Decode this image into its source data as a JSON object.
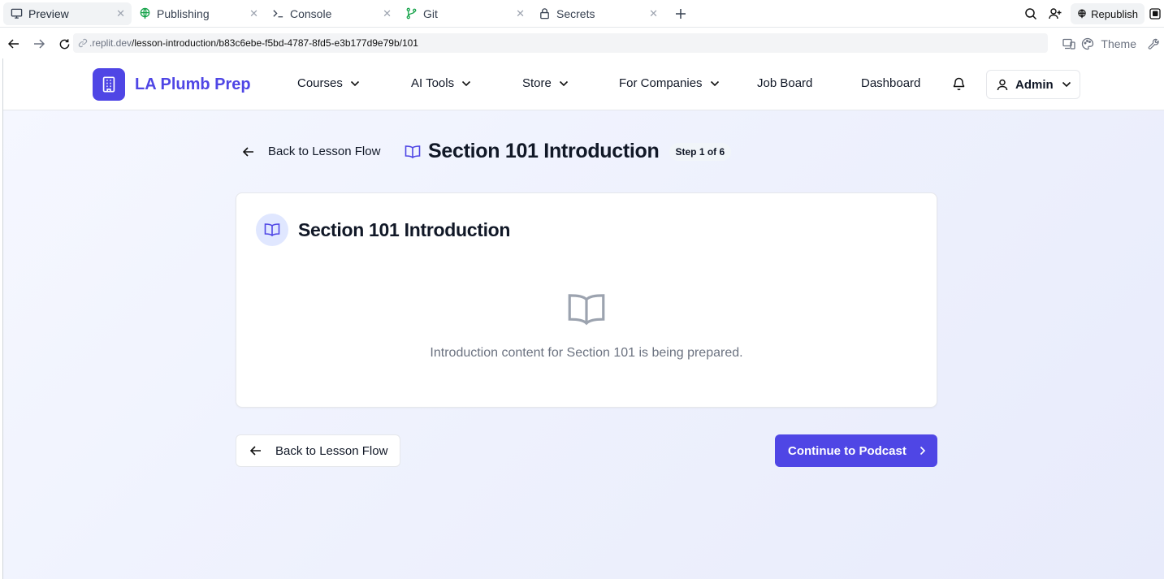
{
  "ide": {
    "tabs": [
      {
        "label": "Preview",
        "icon": "monitor-icon",
        "active": true
      },
      {
        "label": "Publishing",
        "icon": "globe-icon"
      },
      {
        "label": "Console",
        "icon": "terminal-icon"
      },
      {
        "label": "Git",
        "icon": "git-branch-icon"
      },
      {
        "label": "Secrets",
        "icon": "lock-icon"
      }
    ],
    "republish_label": "Republish"
  },
  "urlbar": {
    "host": ".replit.dev",
    "path": "/lesson-introduction/b83c6ebe-f5bd-4787-8fd5-e3b177d9e79b/101",
    "theme_label": "Theme"
  },
  "header": {
    "brand": "LA Plumb Prep",
    "nav": {
      "courses": "Courses",
      "ai_tools": "AI Tools",
      "store": "Store",
      "for_companies": "For Companies",
      "job_board": "Job Board",
      "dashboard": "Dashboard"
    },
    "user_label": "Admin"
  },
  "page": {
    "back_label": "Back to Lesson Flow",
    "title": "Section 101 Introduction",
    "step_badge": "Step 1 of 6"
  },
  "card": {
    "title": "Section 101 Introduction",
    "empty_message": "Introduction content for Section 101 is being prepared."
  },
  "footer_actions": {
    "back_label": "Back to Lesson Flow",
    "continue_label": "Continue to Podcast"
  },
  "colors": {
    "brand": "#4f46e5",
    "brand_light": "#e0e7ff",
    "muted_text": "#6b7280"
  }
}
